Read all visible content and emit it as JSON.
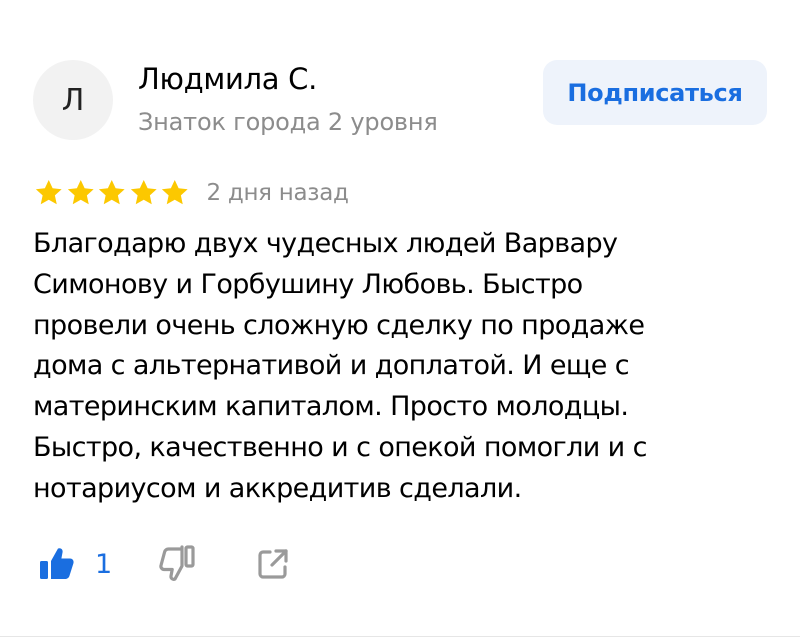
{
  "author": {
    "avatar_letter": "Л",
    "name": "Людмила С.",
    "level": "Знаток города 2 уровня"
  },
  "subscribe_label": "Подписаться",
  "rating": {
    "stars": 5,
    "max_stars": 5,
    "star_color": "#fcc800"
  },
  "date": "2 дня назад",
  "review_text": "Благодарю двух чудесных людей Варвару\nСимонову и Горбушину Любовь. Быстро\nпровели очень сложную сделку по продаже\nдома с альтернативой и доплатой. И еще с\nматеринским капиталом. Просто молодцы.\nБыстро, качественно и с опекой помогли и с\nнотариусом и аккредитив сделали.",
  "actions": {
    "like_count": "1",
    "like_icon": "thumbs-up-icon",
    "dislike_icon": "thumbs-down-icon",
    "share_icon": "share-icon"
  },
  "colors": {
    "accent": "#1a6ee0",
    "secondary_text": "#8c8c8c",
    "button_bg": "#eef3fb",
    "avatar_bg": "#f2f2f2"
  }
}
